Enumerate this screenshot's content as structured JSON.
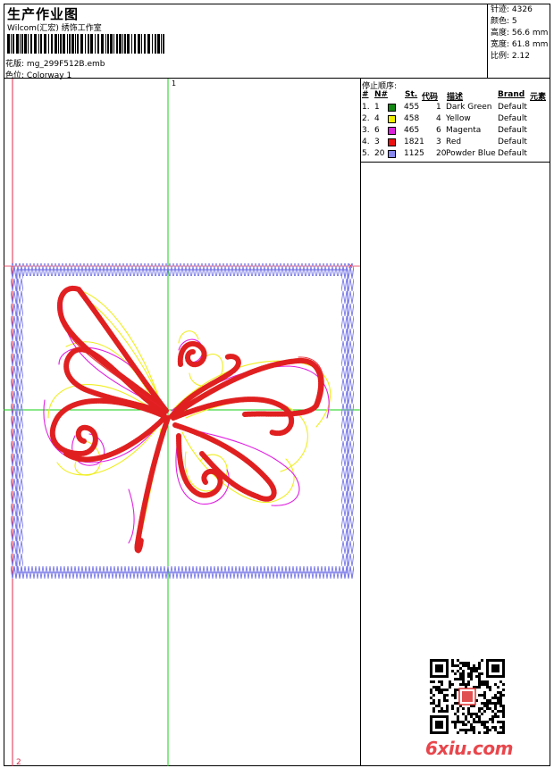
{
  "header": {
    "title": "生产作业图",
    "company": "Wilcom(汇宏) 绣饰工作室",
    "pattern_label": "花版:",
    "pattern_value": "mg_299F512B.emb",
    "colorway_label": "色位:",
    "colorway_value": "Colorway 1"
  },
  "stats": [
    {
      "label": "针迹:",
      "value": "4326"
    },
    {
      "label": "颜色:",
      "value": "5"
    },
    {
      "label": "高度:",
      "value": "56.6 mm"
    },
    {
      "label": "宽度:",
      "value": "61.8 mm"
    },
    {
      "label": "比例:",
      "value": "2.12"
    }
  ],
  "canvas": {
    "marker_1": "1",
    "marker_2": "2",
    "marker_x": "x",
    "colors": {
      "frame": "#7878e8",
      "outline_red": "#e8202a",
      "satin_red": "#e02020",
      "magenta": "#e020e0",
      "yellow": "#f0ee20",
      "guide_green": "#16d016",
      "guide_red": "#e02a4a"
    }
  },
  "stop_sequence": {
    "title": "停止顺序:",
    "headers": {
      "num": "#",
      "n": "N#",
      "st": "St.",
      "code": "代码",
      "desc": "描述",
      "brand": "Brand",
      "element": "元素"
    },
    "rows": [
      {
        "num": "1.",
        "n": "1",
        "color": "#118811",
        "st": "455",
        "code": "1",
        "desc": "Dark Green",
        "brand": "Default"
      },
      {
        "num": "2.",
        "n": "4",
        "color": "#eeee00",
        "st": "458",
        "code": "4",
        "desc": "Yellow",
        "brand": "Default"
      },
      {
        "num": "3.",
        "n": "6",
        "color": "#dd22dd",
        "st": "465",
        "code": "6",
        "desc": "Magenta",
        "brand": "Default"
      },
      {
        "num": "4.",
        "n": "3",
        "color": "#ee1111",
        "st": "1821",
        "code": "3",
        "desc": "Red",
        "brand": "Default"
      },
      {
        "num": "5.",
        "n": "20",
        "color": "#8888ee",
        "st": "1125",
        "code": "20",
        "desc": "Powder Blue",
        "brand": "Default"
      }
    ]
  },
  "watermark": {
    "qr_icon": "qr-code-icon",
    "site": "6xiu.com"
  }
}
